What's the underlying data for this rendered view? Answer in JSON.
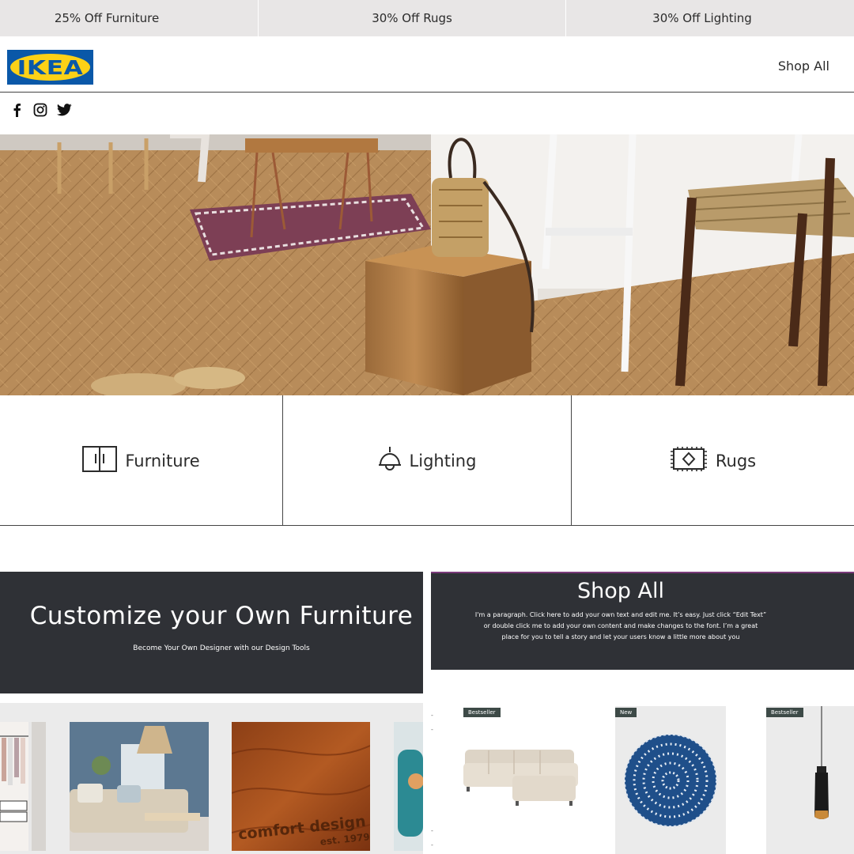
{
  "promo": {
    "items": [
      "25% Off Furniture",
      "30% Off Rugs",
      "30% Off Lighting"
    ]
  },
  "header": {
    "logo_text": "IKEA",
    "shop_all": "Shop All"
  },
  "social": [
    "facebook-icon",
    "instagram-icon",
    "twitter-icon"
  ],
  "categories": [
    {
      "label": "Furniture",
      "icon": "cabinet-icon"
    },
    {
      "label": "Lighting",
      "icon": "lamp-icon"
    },
    {
      "label": "Rugs",
      "icon": "rug-icon"
    }
  ],
  "customize": {
    "title": "Customize your Own Furniture",
    "subtitle": "Become Your Own Designer with our Design Tools"
  },
  "shop_section": {
    "title": "Shop All",
    "paragraph": "I'm a paragraph. Click here to add your own text and edit me. It’s easy. Just click “Edit Text” or double click me to add your own content and make changes to the font. I’m a great place for you to tell a story and let your users know a little more about you"
  },
  "gallery": {
    "stamp_line1": "comfort design",
    "stamp_line2": "est. 1979"
  },
  "products": [
    {
      "badge": "Bestseller",
      "name": "sofa"
    },
    {
      "badge": "New",
      "name": "rug"
    },
    {
      "badge": "Bestseller",
      "name": "pendant-lamp"
    }
  ],
  "colors": {
    "promo_bg": "#e8e6e6",
    "dark_panel": "#2f3136",
    "ikea_blue": "#0a58a8",
    "ikea_yellow": "#fcd117",
    "badge_bg": "#3d4a47"
  }
}
